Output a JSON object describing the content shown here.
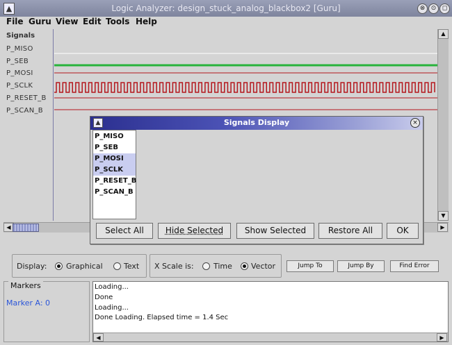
{
  "window": {
    "title": "Logic Analyzer: design_stuck_analog_blackbox2 [Guru]",
    "controls": [
      "⊗",
      "⊙",
      "◻"
    ]
  },
  "menu": [
    "File",
    "Guru",
    "View",
    "Edit",
    "Tools",
    "Help"
  ],
  "signals": {
    "header": "Signals",
    "names": [
      "P_MISO",
      "P_SEB",
      "P_MOSI",
      "P_SCLK",
      "P_RESET_B",
      "P_SCAN_B"
    ]
  },
  "colors": {
    "high": "#28b33b",
    "low": "#b4161c",
    "selection": "#c9cdf0",
    "marker": "#2a55d9"
  },
  "display": {
    "label": "Display:",
    "graphical": "Graphical",
    "text": "Text",
    "selected": "Graphical"
  },
  "xscale": {
    "label": "X Scale is:",
    "time": "Time",
    "vector": "Vector",
    "selected": "Vector"
  },
  "buttons": {
    "jump_to": "Jump To",
    "jump_by": "Jump By",
    "find_error": "Find Error"
  },
  "markers": {
    "title": "Markers",
    "marker_a": "Marker A: 0"
  },
  "log": [
    "Loading...",
    "Done",
    "Loading...",
    "Done Loading. Elapsed time = 1.4 Sec"
  ],
  "dialog": {
    "title": "Signals Display",
    "items": [
      "P_MISO",
      "P_SEB",
      "P_MOSI",
      "P_SCLK",
      "P_RESET_B",
      "P_SCAN_B"
    ],
    "selected": [
      "P_MOSI",
      "P_SCLK"
    ],
    "buttons": {
      "select_all": "Select All",
      "hide_selected": "Hide Selected",
      "show_selected": "Show Selected",
      "restore_all": "Restore All",
      "ok": "OK"
    }
  }
}
